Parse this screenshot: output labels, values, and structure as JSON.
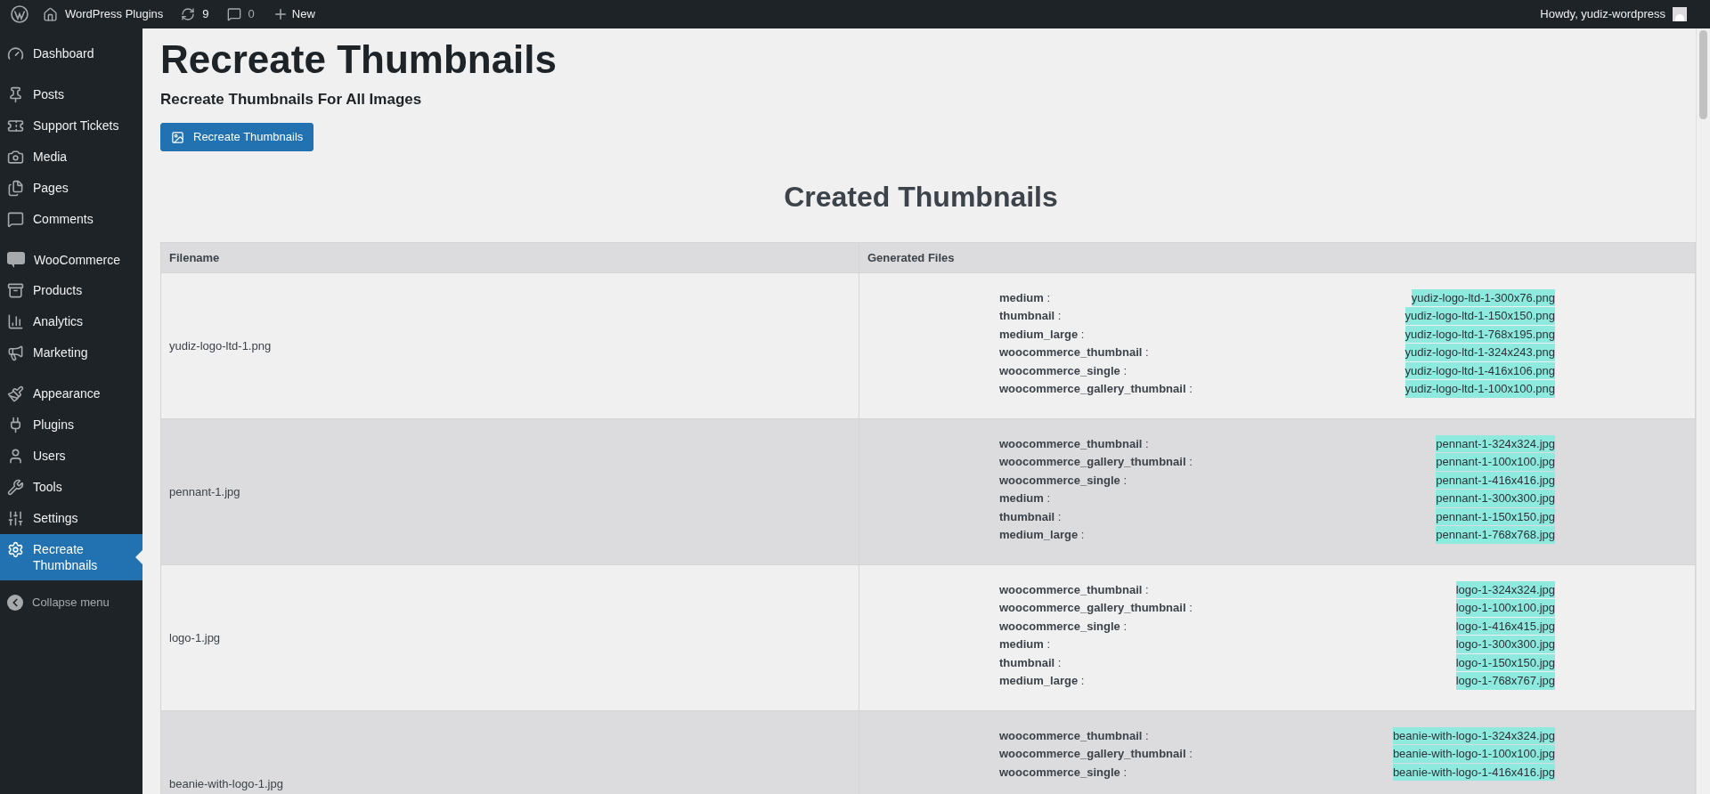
{
  "admin_bar": {
    "site": "WordPress Plugins",
    "updates": "9",
    "comments": "0",
    "new": "New",
    "greeting": "Howdy, yudiz-wordpress"
  },
  "sidebar": {
    "groups": [
      [
        {
          "label": "Dashboard",
          "selected": false
        }
      ],
      [
        {
          "label": "Posts",
          "selected": false
        },
        {
          "label": "Support Tickets",
          "selected": false
        },
        {
          "label": "Media",
          "selected": false
        },
        {
          "label": "Pages",
          "selected": false
        },
        {
          "label": "Comments",
          "selected": false
        }
      ],
      [
        {
          "label": "WooCommerce",
          "selected": false
        },
        {
          "label": "Products",
          "selected": false
        },
        {
          "label": "Analytics",
          "selected": false
        },
        {
          "label": "Marketing",
          "selected": false
        }
      ],
      [
        {
          "label": "Appearance",
          "selected": false
        },
        {
          "label": "Plugins",
          "selected": false
        },
        {
          "label": "Users",
          "selected": false
        },
        {
          "label": "Tools",
          "selected": false
        },
        {
          "label": "Settings",
          "selected": false
        },
        {
          "label": "Recreate Thumbnails",
          "selected": true
        }
      ]
    ],
    "collapse": "Collapse menu"
  },
  "page": {
    "title": "Recreate Thumbnails",
    "subtitle": "Recreate Thumbnails For All Images",
    "button": "Recreate Thumbnails",
    "section_title": "Created Thumbnails"
  },
  "table": {
    "columns": [
      "Filename",
      "Generated Files"
    ],
    "rows": [
      {
        "filename": "yudiz-logo-ltd-1.png",
        "files": [
          [
            "**medium** :",
            "yudiz-logo-ltd-1-300x76.png"
          ],
          [
            "**thumbnail** :",
            "yudiz-logo-ltd-1-150x150.png"
          ],
          [
            "**medium_large** :",
            "yudiz-logo-ltd-1-768x195.png"
          ],
          [
            "**woocommerce_thumbnail** :",
            "yudiz-logo-ltd-1-324x243.png"
          ],
          [
            "**woocommerce_single** :",
            "yudiz-logo-ltd-1-416x106.png"
          ],
          [
            "**woocommerce_gallery_thumbnail** :",
            "yudiz-logo-ltd-1-100x100.png"
          ]
        ]
      },
      {
        "filename": "pennant-1.jpg",
        "files": [
          [
            "**woocommerce_thumbnail** :",
            "pennant-1-324x324.jpg"
          ],
          [
            "**woocommerce_gallery_thumbnail** :",
            "pennant-1-100x100.jpg"
          ],
          [
            "**woocommerce_single** :",
            "pennant-1-416x416.jpg"
          ],
          [
            "**medium** :",
            "pennant-1-300x300.jpg"
          ],
          [
            "**thumbnail** :",
            "pennant-1-150x150.jpg"
          ],
          [
            "**medium_large** :",
            "pennant-1-768x768.jpg"
          ]
        ]
      },
      {
        "filename": "logo-1.jpg",
        "files": [
          [
            "**woocommerce_thumbnail** :",
            "logo-1-324x324.jpg"
          ],
          [
            "**woocommerce_gallery_thumbnail** :",
            "logo-1-100x100.jpg"
          ],
          [
            "**woocommerce_single** :",
            "logo-1-416x415.jpg"
          ],
          [
            "**medium** :",
            "logo-1-300x300.jpg"
          ],
          [
            "**thumbnail** :",
            "logo-1-150x150.jpg"
          ],
          [
            "**medium_large** :",
            "logo-1-768x767.jpg"
          ]
        ]
      },
      {
        "filename": "beanie-with-logo-1.jpg",
        "files": [
          [
            "**woocommerce_thumbnail** :",
            "beanie-with-logo-1-324x324.jpg"
          ],
          [
            "**woocommerce_gallery_thumbnail** :",
            "beanie-with-logo-1-100x100.jpg"
          ],
          [
            "**woocommerce_single** :",
            "beanie-with-logo-1-416x416.jpg"
          ]
        ]
      }
    ]
  }
}
